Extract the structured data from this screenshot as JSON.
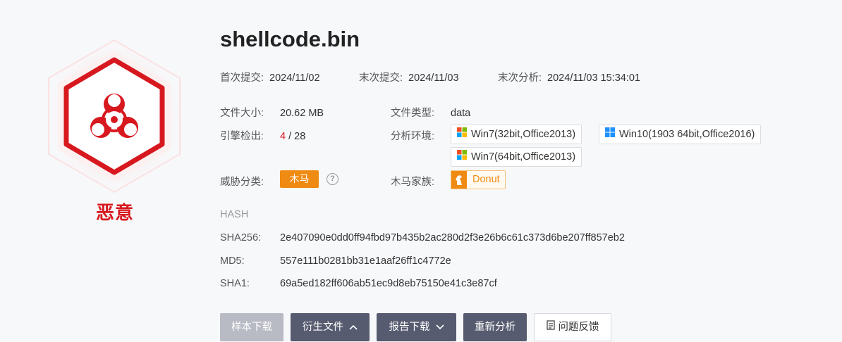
{
  "file": {
    "name": "shellcode.bin",
    "verdict": "恶意"
  },
  "dates": {
    "first_submit_label": "首次提交:",
    "first_submit_value": "2024/11/02",
    "last_submit_label": "末次提交:",
    "last_submit_value": "2024/11/03",
    "last_analysis_label": "末次分析:",
    "last_analysis_value": "2024/11/03 15:34:01"
  },
  "info": {
    "size_label": "文件大小:",
    "size_value": "20.62 MB",
    "type_label": "文件类型:",
    "type_value": "data",
    "engine_label": "引擎检出:",
    "engine_detected": "4",
    "engine_sep": " / ",
    "engine_total": "28",
    "env_label": "分析环境:",
    "environments": [
      {
        "label": "Win7(32bit,Office2013)",
        "icon": "windows7-icon"
      },
      {
        "label": "Win10(1903 64bit,Office2016)",
        "icon": "windows10-icon"
      },
      {
        "label": "Win7(64bit,Office2013)",
        "icon": "windows7-icon"
      }
    ],
    "threat_label": "威胁分类:",
    "threat_value": "木马",
    "help_glyph": "?",
    "family_label": "木马家族:",
    "family_value": "Donut"
  },
  "hash": {
    "heading": "HASH",
    "sha256_label": "SHA256:",
    "sha256_value": "2e407090e0dd0ff94fbd97b435b2ac280d2f3e26b6c61c373d6be207ff857eb2",
    "md5_label": "MD5:",
    "md5_value": "557e111b0281bb31e1aaf26ff1c4772e",
    "sha1_label": "SHA1:",
    "sha1_value": "69a5ed182ff606ab51ec9d8eb75150e41c3e87cf"
  },
  "buttons": {
    "sample_download": "样本下载",
    "derived_files": "衍生文件",
    "report_download": "报告下载",
    "reanalyze": "重新分析",
    "feedback": "问题反馈"
  },
  "colors": {
    "malicious_red": "#d7191f",
    "trojan_orange": "#ef8a12",
    "button_dark": "#575b70",
    "button_disabled": "#b8bac4"
  }
}
